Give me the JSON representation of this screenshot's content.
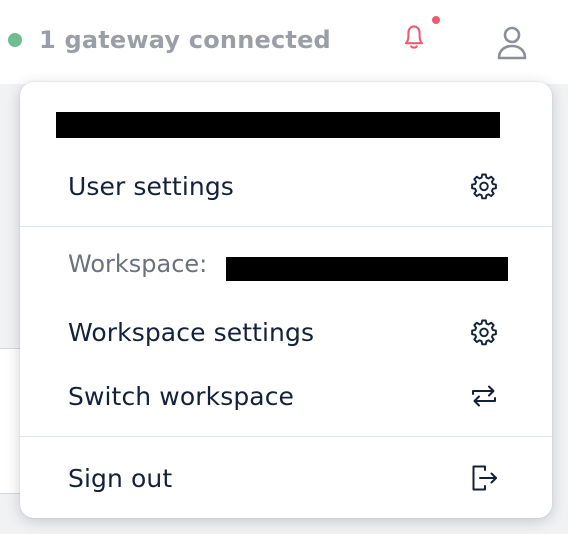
{
  "header": {
    "gateway_status": "1 gateway connected",
    "status_color": "#6fbf8e",
    "notification_icon": "bell-icon",
    "notification_color": "#ef5a6e",
    "account_icon": "user-icon"
  },
  "menu": {
    "user_settings_label": "User settings",
    "user_settings_icon": "gear-icon",
    "workspace_prefix": "Workspace:",
    "workspace_settings_label": "Workspace settings",
    "workspace_settings_icon": "gear-icon",
    "switch_workspace_label": "Switch workspace",
    "switch_workspace_icon": "swap-arrows-icon",
    "sign_out_label": "Sign out",
    "sign_out_icon": "sign-out-icon"
  }
}
